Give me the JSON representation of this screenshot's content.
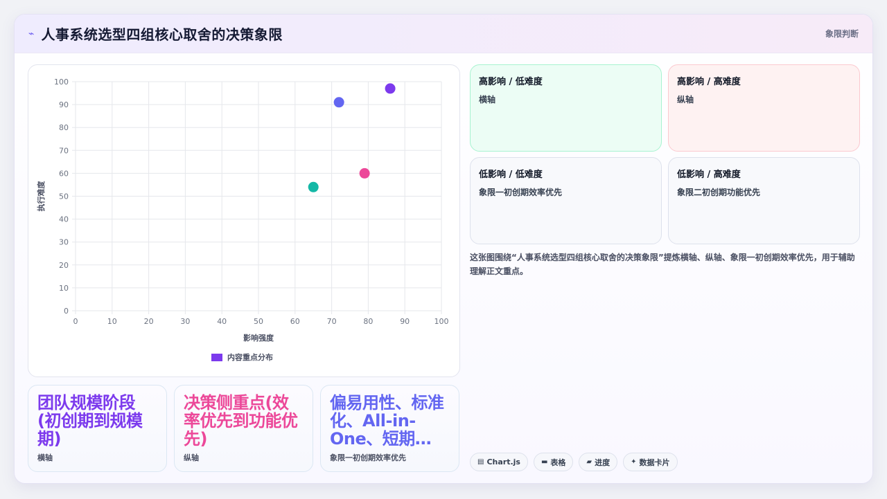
{
  "header": {
    "icon": "lightning-icon",
    "title": "人事系统选型四组核心取舍的决策象限",
    "tag": "象限判断"
  },
  "chart_data": {
    "type": "scatter",
    "title": "",
    "xlabel": "影响强度",
    "ylabel": "执行难度",
    "xlim": [
      0,
      100
    ],
    "ylim": [
      0,
      100
    ],
    "xticks": [
      0,
      10,
      20,
      30,
      40,
      50,
      60,
      70,
      80,
      90,
      100
    ],
    "yticks": [
      0,
      10,
      20,
      30,
      40,
      50,
      60,
      70,
      80,
      90,
      100
    ],
    "grid": true,
    "legend": {
      "position": "bottom",
      "label": "内容重点分布",
      "color": "#7c3aed"
    },
    "points": [
      {
        "x": 86,
        "y": 97,
        "color": "#7c3aed"
      },
      {
        "x": 72,
        "y": 91,
        "color": "#6366f1"
      },
      {
        "x": 79,
        "y": 60,
        "color": "#ec4899"
      },
      {
        "x": 65,
        "y": 54,
        "color": "#14b8a6"
      }
    ]
  },
  "stats": [
    {
      "value": "团队规模阶段(初创期到规模期)",
      "label": "横轴",
      "color": "#7c3aed"
    },
    {
      "value": "决策侧重点(效率优先到功能优先)",
      "label": "纵轴",
      "color": "#ec4899"
    },
    {
      "value": "偏易用性、标准化、All-in-One、短期…",
      "label": "象限一初创期效率优先",
      "color": "#6366f1"
    }
  ],
  "quadrants": [
    {
      "title": "高影响 / 低难度",
      "desc": "横轴",
      "bg": "#ecfdf5",
      "border": "#a7f3d0"
    },
    {
      "title": "高影响 / 高难度",
      "desc": "纵轴",
      "bg": "#fef2f2",
      "border": "#fbc9cf"
    },
    {
      "title": "低影响 / 低难度",
      "desc": "象限一初创期效率优先",
      "bg": "#f8f9fc",
      "border": "#dde1ec"
    },
    {
      "title": "低影响 / 高难度",
      "desc": "象限二初创期功能优先",
      "bg": "#f8f9fc",
      "border": "#dde1ec"
    }
  ],
  "description": "这张图围绕“人事系统选型四组核心取舍的决策象限”提炼横轴、纵轴、象限一初创期效率优先，用于辅助理解正文重点。",
  "chips": [
    {
      "icon": "chart-icon",
      "glyph": "▤",
      "label": "Chart.js"
    },
    {
      "icon": "table-icon",
      "glyph": "▬",
      "label": "表格"
    },
    {
      "icon": "folder-icon",
      "glyph": "▰",
      "label": "进度"
    },
    {
      "icon": "sparkle-icon",
      "glyph": "✦",
      "label": "数据卡片"
    }
  ]
}
